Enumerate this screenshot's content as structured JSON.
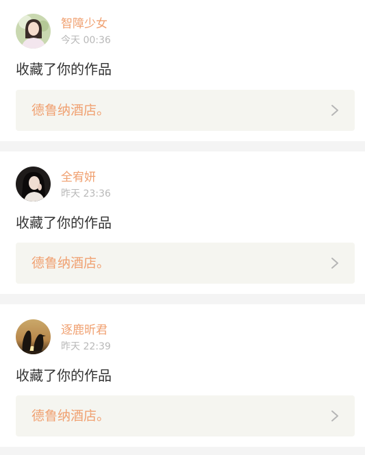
{
  "notifications": [
    {
      "username": "智障少女",
      "time": "今天 00:36",
      "action": "收藏了你的作品",
      "work_title": "德鲁纳酒店。",
      "avatar_icon": "avatar-girl-portrait-icon",
      "link_icon": "chevron-right-icon"
    },
    {
      "username": "全宥妍",
      "time": "昨天 23:36",
      "action": "收藏了你的作品",
      "work_title": "德鲁纳酒店。",
      "avatar_icon": "avatar-dark-hair-portrait-icon",
      "link_icon": "chevron-right-icon"
    },
    {
      "username": "逐鹿昕君",
      "time": "昨天 22:39",
      "action": "收藏了你的作品",
      "work_title": "德鲁纳酒店。",
      "avatar_icon": "avatar-penguins-sunset-icon",
      "link_icon": "chevron-right-icon"
    }
  ],
  "colors": {
    "accent": "#f0a070",
    "secondary_text": "#b8b8b8",
    "body_text": "#333333",
    "link_background": "#f5f5f0",
    "page_background": "#f4f4f4"
  }
}
